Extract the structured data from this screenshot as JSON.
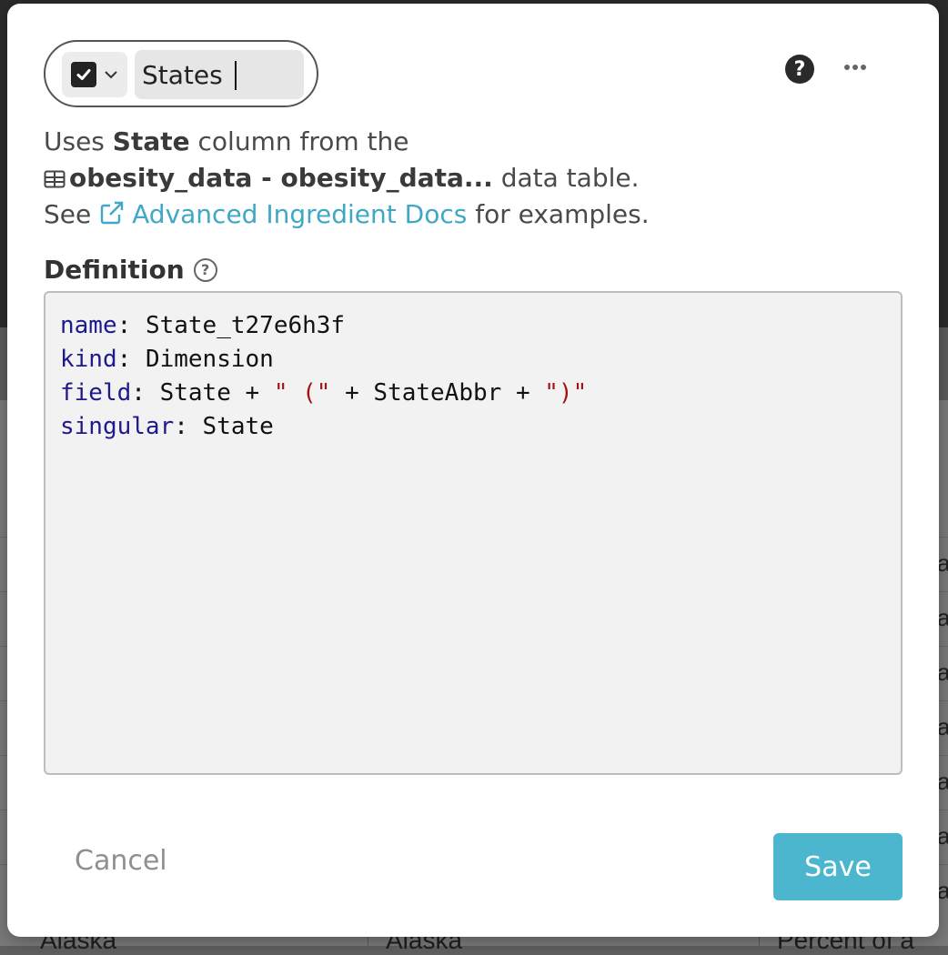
{
  "dialog": {
    "ingredient_name": "States",
    "help_symbol": "?",
    "description": {
      "line1_prefix": "Uses ",
      "column": "State",
      "line1_suffix": " column from the",
      "table_name": "obesity_data - obesity_data...",
      "line2_suffix": " data table.",
      "line3_prefix": "See ",
      "docs_link": "Advanced Ingredient Docs",
      "line3_suffix": " for examples."
    },
    "definition_label": "Definition",
    "definition_help": "?",
    "definition": {
      "name_key": "name",
      "name_value": "State_t27e6h3f",
      "kind_key": "kind",
      "kind_value": "Dimension",
      "field_key": "field",
      "field_part1": "State + ",
      "field_str1": "\" (\"",
      "field_part2": " + StateAbbr + ",
      "field_str2": "\")\"",
      "singular_key": "singular",
      "singular_value": "State"
    },
    "cancel_label": "Cancel",
    "save_label": "Save"
  },
  "background": {
    "cell_letter": "a",
    "bottom_left": "Alaska",
    "bottom_middle": "Alaska",
    "bottom_right": "Percent of a"
  },
  "colors": {
    "accent": "#4db6cf",
    "link": "#3fa8c6",
    "keyword": "#1f1a8c",
    "string": "#a31515"
  }
}
